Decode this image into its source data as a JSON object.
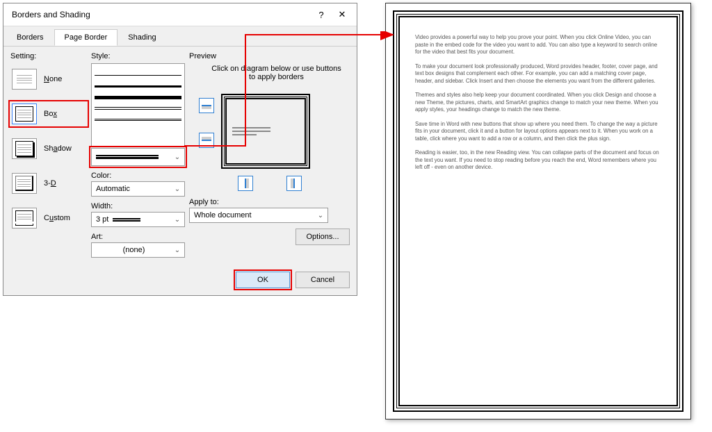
{
  "dialog": {
    "title": "Borders and Shading",
    "tabs": {
      "borders": "Borders",
      "page_border": "Page Border",
      "shading": "Shading",
      "active": "page_border"
    },
    "setting": {
      "label": "Setting:",
      "none": "None",
      "box": "Box",
      "shadow": "Shadow",
      "threed": "3-D",
      "custom": "Custom",
      "selected": "box"
    },
    "style": {
      "label": "Style:",
      "color_label": "Color:",
      "color_value": "Automatic",
      "width_label": "Width:",
      "width_value": "3 pt",
      "art_label": "Art:",
      "art_value": "(none)"
    },
    "preview": {
      "label": "Preview",
      "hint": "Click on diagram below or use buttons to apply borders"
    },
    "apply_to": {
      "label": "Apply to:",
      "value": "Whole document"
    },
    "options_btn": "Options...",
    "ok_btn": "OK",
    "cancel_btn": "Cancel"
  },
  "document": {
    "paragraphs": [
      "Video provides a powerful way to help you prove your point. When you click Online Video, you can paste in the embed code for the video you want to add. You can also type a keyword to search online for the video that best fits your document.",
      "To make your document look professionally produced, Word provides header, footer, cover page, and text box designs that complement each other. For example, you can add a matching cover page, header, and sidebar. Click Insert and then choose the elements you want from the different galleries.",
      "Themes and styles also help keep your document coordinated. When you click Design and choose a new Theme, the pictures, charts, and SmartArt graphics change to match your new theme. When you apply styles, your headings change to match the new theme.",
      "Save time in Word with new buttons that show up where you need them. To change the way a picture fits in your document, click it and a button for layout options appears next to it. When you work on a table, click where you want to add a row or a column, and then click the plus sign.",
      "Reading is easier, too, in the new Reading view. You can collapse parts of the document and focus on the text you want. If you need to stop reading before you reach the end, Word remembers where you left off - even on another device."
    ]
  }
}
